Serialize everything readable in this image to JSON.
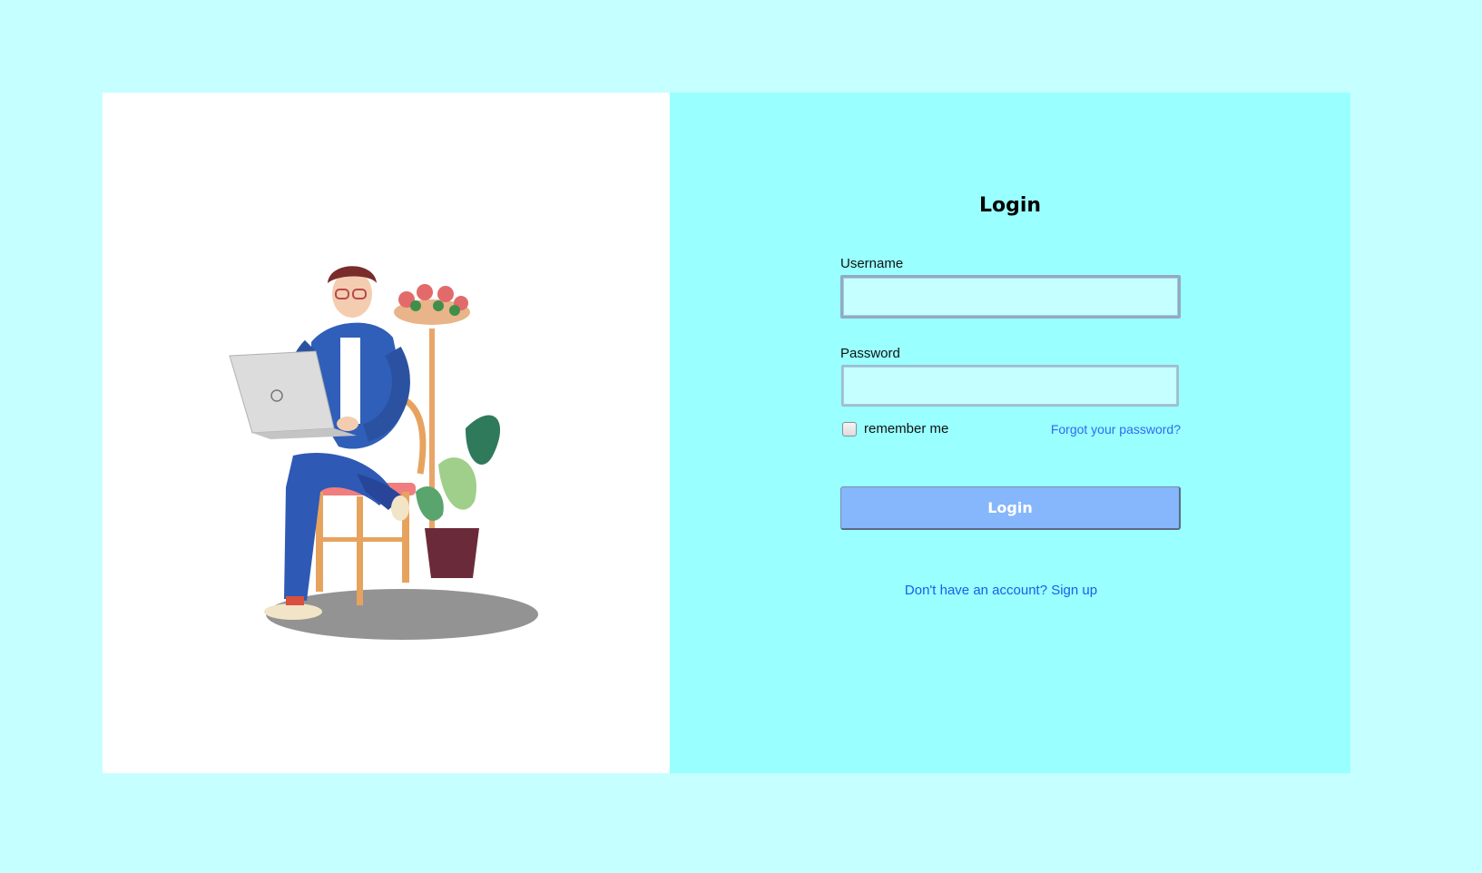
{
  "login": {
    "title": "Login",
    "username_label": "Username",
    "username_value": "",
    "password_label": "Password",
    "password_value": "",
    "remember_label": "remember me",
    "remember_checked": false,
    "forgot_link": "Forgot your password?",
    "submit_label": "Login",
    "signup_link": "Don't have an account? Sign up"
  },
  "colors": {
    "page_background": "#c6ffff",
    "panel_background": "#99ffff",
    "input_background": "#c6ffff",
    "button_background": "#86b6fc",
    "link": "#2f6bf2"
  },
  "illustration": {
    "description_icon": "person-with-laptop-illustration"
  }
}
